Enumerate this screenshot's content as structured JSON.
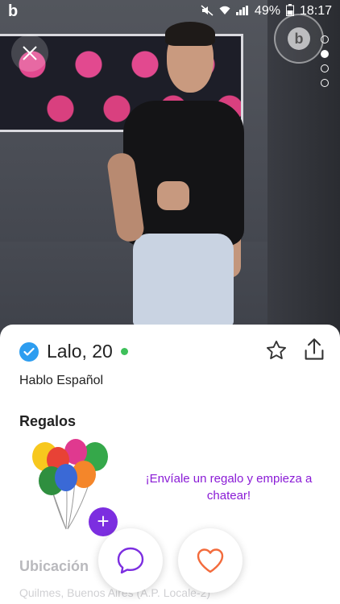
{
  "statusbar": {
    "app_logo": "b",
    "battery": "49%",
    "time": "18:17"
  },
  "photo": {
    "pager_count": 4,
    "pager_active": 1
  },
  "profile": {
    "name": "Lalo, 20",
    "verified": true,
    "online": true,
    "languages": "Hablo Español"
  },
  "gifts": {
    "title": "Regalos",
    "cta": "¡Envíale un regalo y empieza a chatear!"
  },
  "location": {
    "title": "Ubicación",
    "value": "Quilmes, Buenos Aires (A.P. Locale-2)"
  },
  "colors": {
    "accent_purple": "#7c2ee0",
    "verified_blue": "#2d9df0",
    "online_green": "#3ec05a",
    "like_orange": "#f36b3c"
  },
  "icons": {
    "close": "close-icon",
    "favorite": "star-icon",
    "share": "share-icon",
    "chat": "chat-bubble-icon",
    "like": "heart-icon"
  }
}
